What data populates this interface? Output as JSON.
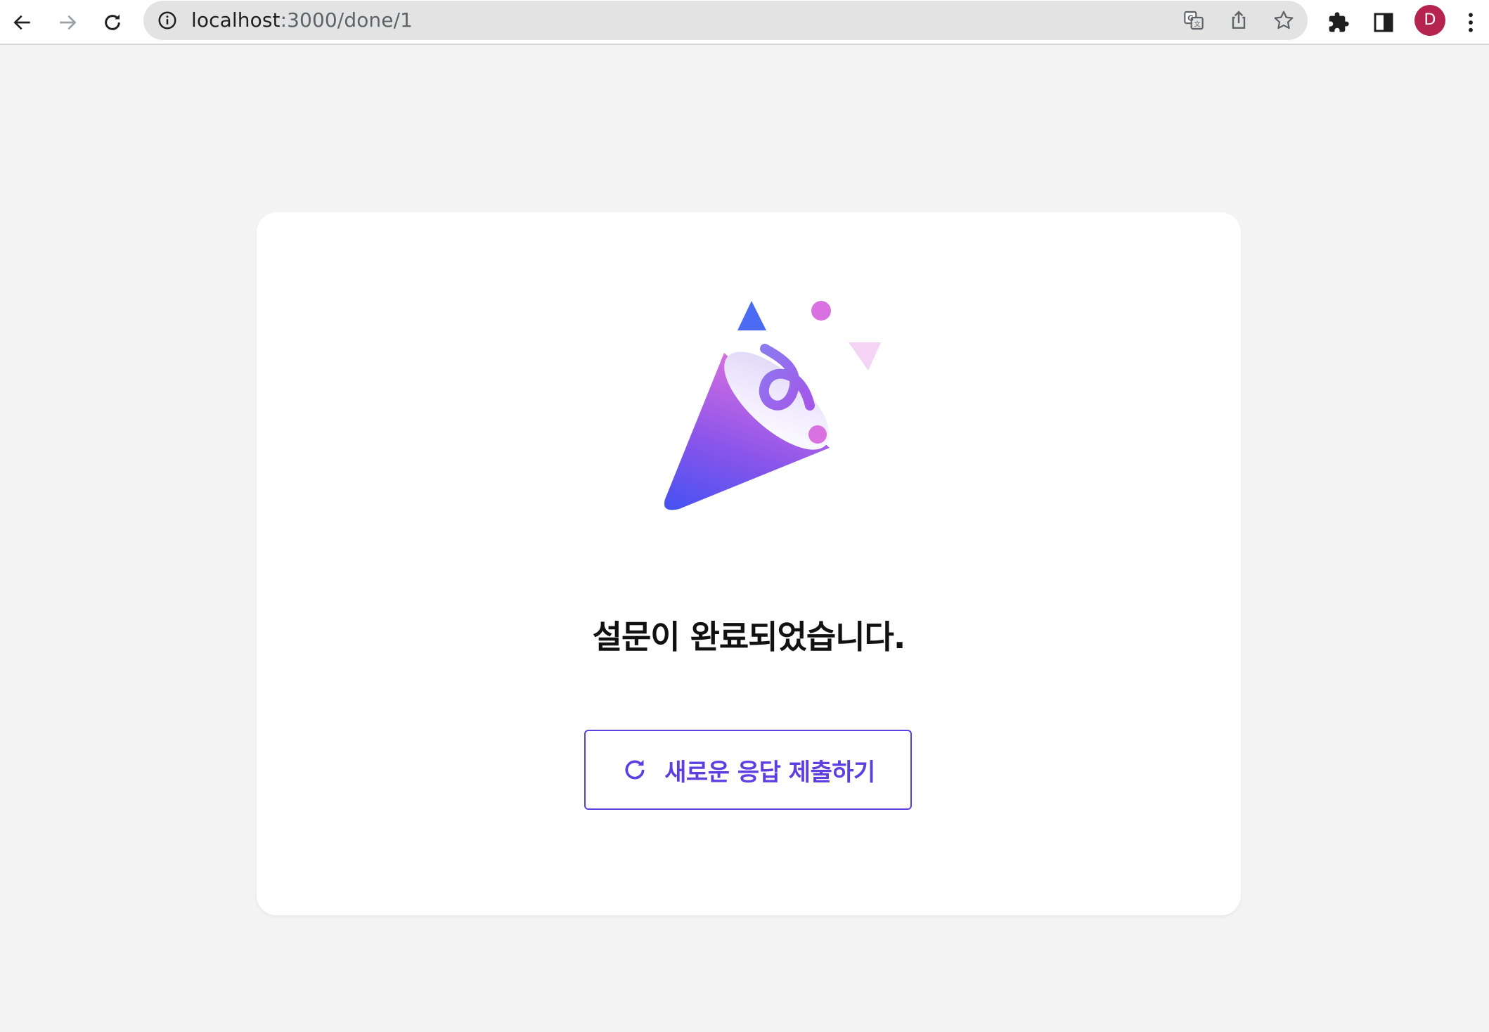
{
  "browser": {
    "url_host": "localhost",
    "url_path": ":3000/done/1",
    "profile_initial": "D",
    "profile_color": "#b5234f",
    "icons": [
      "back-icon",
      "forward-icon",
      "reload-icon",
      "info-icon",
      "translate-icon",
      "share-icon",
      "bookmark-star-icon",
      "extensions-icon",
      "side-panel-icon",
      "menu-icon"
    ]
  },
  "page": {
    "title": "설문이 완료되었습니다.",
    "button_label": "새로운 응답 제출하기",
    "accent_color": "#5b3fe0"
  }
}
